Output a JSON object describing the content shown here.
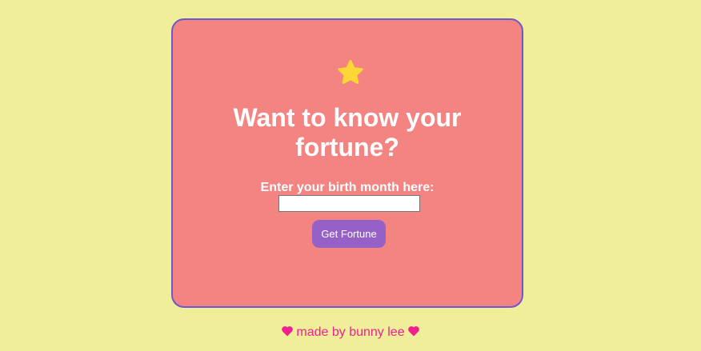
{
  "card": {
    "star_icon": "star-icon",
    "title": "Want to know your fortune?",
    "label": "Enter your birth month here:",
    "input_value": "",
    "button_label": "Get Fortune"
  },
  "footer": {
    "text": "made by bunny lee",
    "heart_icon": "heart-icon"
  },
  "colors": {
    "background": "#f0ee98",
    "card": "#f38482",
    "card_border": "#6a5acd",
    "button": "#9661c7",
    "star": "#fdd835",
    "footer_text": "#f0208e"
  }
}
